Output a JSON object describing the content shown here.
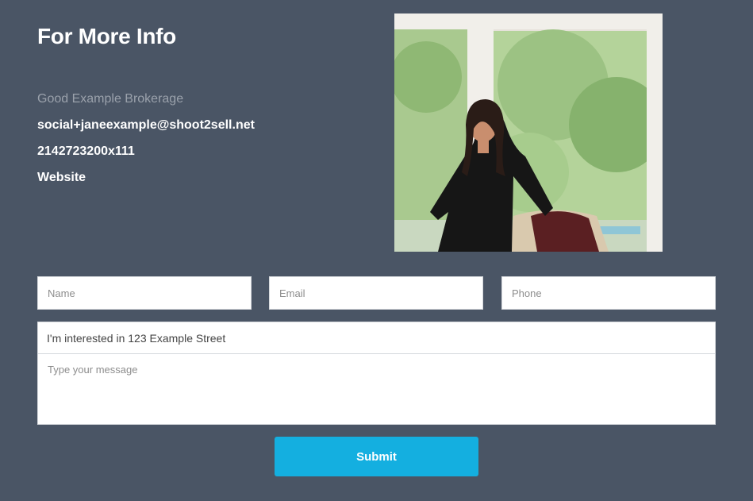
{
  "section": {
    "title": "For More Info"
  },
  "agent": {
    "brokerage": "Good Example Brokerage",
    "email": "social+janeexample@shoot2sell.net",
    "phone": "2142723200x111",
    "website_label": "Website"
  },
  "photo": {
    "icon": "agent-photo"
  },
  "form": {
    "name_placeholder": "Name",
    "email_placeholder": "Email",
    "phone_placeholder": "Phone",
    "subject_value": "I'm interested in 123 Example Street",
    "message_placeholder": "Type your message",
    "submit_label": "Submit"
  },
  "colors": {
    "background": "#4a5565",
    "accent": "#14afe0",
    "muted_text": "#9aa1ab"
  }
}
